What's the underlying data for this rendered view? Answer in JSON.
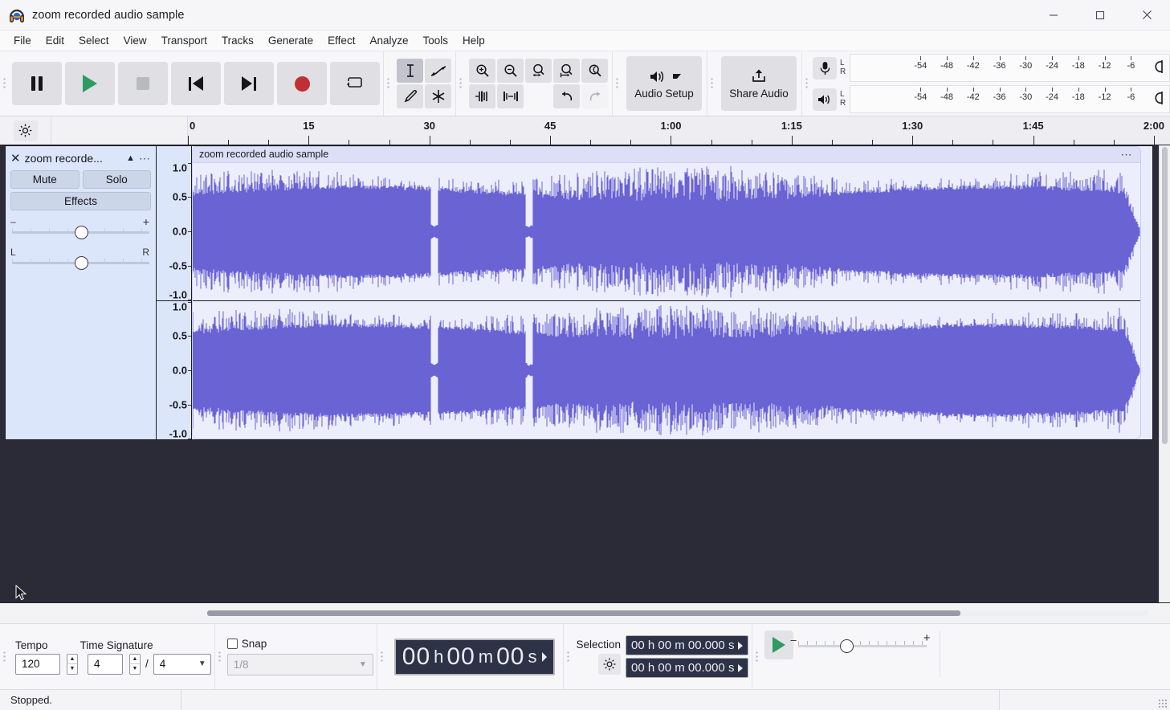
{
  "window": {
    "title": "zoom recorded audio sample",
    "app_icon": "audacity-headphones-icon",
    "minimize": "—",
    "maximize": "☐",
    "close": "✕"
  },
  "menu": {
    "items": [
      {
        "label": "File"
      },
      {
        "label": "Edit"
      },
      {
        "label": "Select"
      },
      {
        "label": "View"
      },
      {
        "label": "Transport"
      },
      {
        "label": "Tracks"
      },
      {
        "label": "Generate"
      },
      {
        "label": "Effect"
      },
      {
        "label": "Analyze"
      },
      {
        "label": "Tools"
      },
      {
        "label": "Help"
      }
    ]
  },
  "toolbar": {
    "transport": [
      {
        "name": "pause-button",
        "icon": "pause-icon"
      },
      {
        "name": "play-button",
        "icon": "play-icon"
      },
      {
        "name": "stop-button",
        "icon": "stop-icon"
      },
      {
        "name": "skip-to-start-button",
        "icon": "skip-start-icon"
      },
      {
        "name": "skip-to-end-button",
        "icon": "skip-end-icon"
      },
      {
        "name": "record-button",
        "icon": "record-icon"
      },
      {
        "name": "loop-button",
        "icon": "loop-icon"
      }
    ],
    "tools": [
      {
        "name": "selection-tool",
        "icon": "i-beam-icon",
        "selected": true
      },
      {
        "name": "envelope-tool",
        "icon": "envelope-icon",
        "selected": false
      },
      {
        "name": "draw-tool",
        "icon": "pencil-icon",
        "selected": false
      },
      {
        "name": "multi-tool",
        "icon": "asterisk-icon",
        "selected": false
      }
    ],
    "zoom_tools": [
      {
        "name": "zoom-in-button",
        "icon": "zoom-in-icon"
      },
      {
        "name": "zoom-out-button",
        "icon": "zoom-out-icon"
      },
      {
        "name": "fit-selection-button",
        "icon": "fit-selection-icon"
      },
      {
        "name": "fit-project-button",
        "icon": "fit-project-icon"
      },
      {
        "name": "zoom-toggle-button",
        "icon": "zoom-toggle-icon"
      },
      {
        "name": "trim-audio-button",
        "icon": "trim-outside-icon"
      },
      {
        "name": "silence-audio-button",
        "icon": "silence-selection-icon"
      },
      {
        "name": "undo-button",
        "icon": "undo-icon"
      },
      {
        "name": "redo-button",
        "icon": "redo-icon"
      }
    ],
    "audio_setup_label": "Audio Setup",
    "audio_setup_icon": "speaker-icon",
    "share_audio_label": "Share Audio",
    "share_audio_icon": "upload-icon"
  },
  "meters": {
    "record": {
      "icon": "microphone-icon",
      "left": "L",
      "right": "R",
      "clip_icon": "clip-indicator-icon"
    },
    "play": {
      "icon": "speaker-icon",
      "left": "L",
      "right": "R",
      "clip_icon": "clip-indicator-icon"
    },
    "db_scale": [
      "-54",
      "-48",
      "-42",
      "-36",
      "-30",
      "-24",
      "-18",
      "-12",
      "-6"
    ]
  },
  "timeline": {
    "settings_icon": "gear-icon",
    "major_labels": [
      "0",
      "15",
      "30",
      "45",
      "1:00",
      "1:15",
      "1:30",
      "1:45",
      "2:00"
    ],
    "major_seconds": [
      0,
      15,
      30,
      45,
      60,
      75,
      90,
      105,
      120
    ],
    "minor_interval_seconds": 5,
    "visible_range_seconds": [
      0,
      122
    ]
  },
  "track": {
    "close_icon": "close-icon",
    "name": "zoom recorde...",
    "collapse_icon": "chevron-up-icon",
    "menu_icon": "overflow-menu-icon",
    "mute_label": "Mute",
    "solo_label": "Solo",
    "effects_label": "Effects",
    "gain_slider": {
      "min_label": "–",
      "max_label": "+",
      "value_pct": 50
    },
    "pan_slider": {
      "min_label": "L",
      "max_label": "R",
      "value_pct": 50
    },
    "vertical_ruler_labels": [
      "1.0",
      "0.5",
      "0.0",
      "-0.5",
      "-1.0"
    ],
    "clip_title": "zoom recorded audio sample",
    "clip_menu_icon": "overflow-menu-icon",
    "waveform_color": "#6a63d4",
    "waveform_bg": "#eceefc",
    "panel_bg": "#dce6fb",
    "channels": 2
  },
  "bottom": {
    "tempo_label": "Tempo",
    "tempo_value": "120",
    "time_signature_label": "Time Signature",
    "time_signature_upper": "4",
    "time_signature_divider": "/",
    "time_signature_lower": "4",
    "snap_label": "Snap",
    "snap_checked": false,
    "snap_value": "1/8",
    "audio_position": {
      "hours": "00",
      "h_unit": "h",
      "minutes": "00",
      "m_unit": "m",
      "seconds": "00",
      "s_unit": "s"
    },
    "selection_label": "Selection",
    "selection_settings_icon": "gear-icon",
    "selection_start": "00 h 00 m 00.000 s",
    "selection_end": "00 h 00 m 00.000 s",
    "play_speed_icon": "play-icon",
    "play_speed_min": "–",
    "play_speed_max": "+",
    "play_speed_pct": 33
  },
  "status": {
    "message": "Stopped."
  },
  "colors": {
    "accent_waveform": "#6a63d4",
    "play_green": "#2e9b63",
    "record_red": "#bf2f33",
    "track_area_bg": "#2b2b38",
    "time_display_bg": "#2e3247"
  }
}
